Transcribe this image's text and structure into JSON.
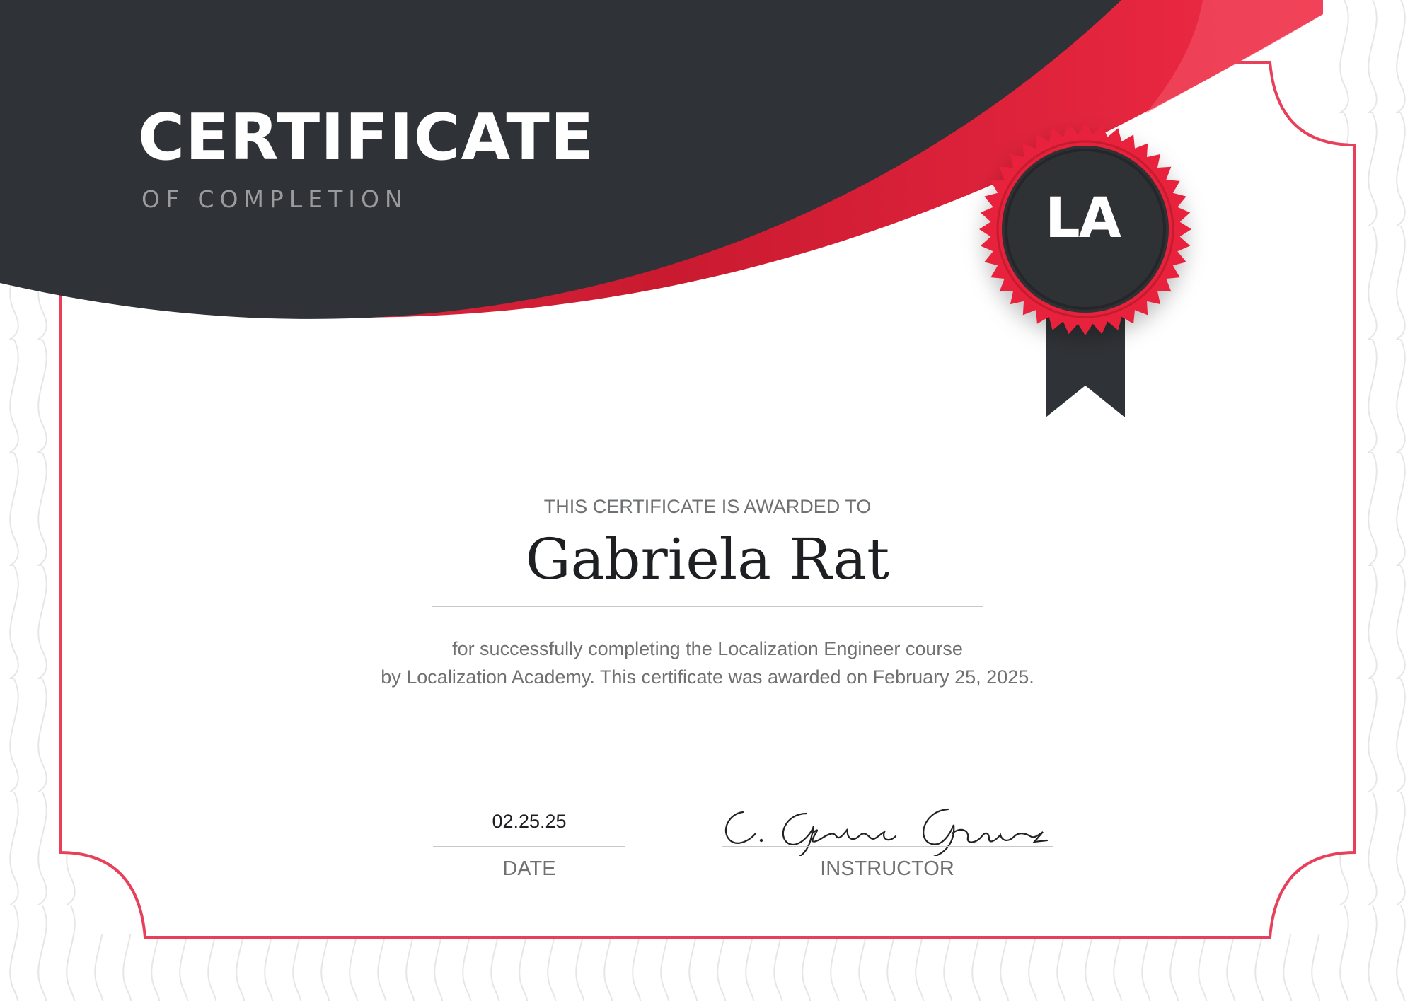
{
  "header": {
    "title": "CERTIFICATE",
    "subtitle": "OF COMPLETION"
  },
  "seal": {
    "logo_text": "LA",
    "ribbon_color": "#2f3236",
    "rosette_color": "#e8243c"
  },
  "body": {
    "awarded_text": "THIS CERTIFICATE IS AWARDED TO",
    "recipient_name": "Gabriela Rat",
    "description_line1": "for successfully completing the Localization Engineer course",
    "description_line2": "by Localization Academy. This certificate was awarded on February 25, 2025."
  },
  "footer": {
    "date_value": "02.25.25",
    "date_label": "DATE",
    "signature_text": "C. García Gómez",
    "instructor_label": "INSTRUCTOR"
  },
  "colors": {
    "dark": "#2f3236",
    "accent_red": "#e8243c",
    "border_red": "#e8405a",
    "text_gray": "#6f7072"
  }
}
